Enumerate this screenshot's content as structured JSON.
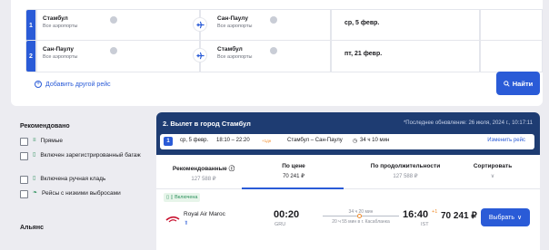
{
  "search": {
    "segments": [
      {
        "num": "1",
        "from_city": "Стамбул",
        "from_airports": "Все аэропорты",
        "to_city": "Сан-Паулу",
        "to_airports": "Все аэропорты",
        "date": "ср, 5 февр."
      },
      {
        "num": "2",
        "from_city": "Сан-Паулу",
        "from_airports": "Все аэропорты",
        "to_city": "Стамбул",
        "to_airports": "Все аэропорты",
        "date": "пт, 21 февр."
      }
    ],
    "add_flight": "Добавить другой рейс",
    "find_button": "Найти"
  },
  "filters": {
    "recommended_title": "Рекомендовано",
    "items": [
      {
        "label": "Прямые"
      },
      {
        "label": "Включен зарегистрированный багаж"
      },
      {
        "label": "Включена ручная кладь"
      },
      {
        "label": "Рейсы с низкими выбросами"
      }
    ],
    "alliance_title": "Альянс"
  },
  "results": {
    "title": "2. Вылет в город Стамбул",
    "updated": "*Последнее обновление: 26 июля, 2024 г., 10:17:11",
    "bar": {
      "badge": "1",
      "date": "ср, 5 февр.",
      "time": "18:10 – 22:20",
      "time_plus": "+1дн",
      "route": "Стамбул – Сан-Паулу",
      "duration": "34 ч 10 мин",
      "change": "Изменить рейс"
    },
    "sort": [
      {
        "label": "Рекомендованные",
        "value": "127 588 ₽"
      },
      {
        "label": "По цене",
        "value": "70 241 ₽"
      },
      {
        "label": "По продолжительности",
        "value": "127 588 ₽"
      },
      {
        "label": "Сортировать",
        "value": "∨"
      }
    ],
    "flight": {
      "badge": "Включена",
      "airline": "Royal Air Maroc",
      "dep_time": "00:20",
      "dep_airport": "GRU",
      "duration": "34 ч 20 мин",
      "stop": "20 ч 55 мин в г. Касабланка",
      "arr_time": "16:40",
      "arr_plus": "+1",
      "arr_airport": "IST",
      "price": "70 241 ₽",
      "select": "Выбрать"
    }
  },
  "colors": {
    "accent": "#2a5bd7",
    "header": "#1e3c72",
    "eco": "#2a8f5a",
    "warn": "#f08c2a"
  }
}
